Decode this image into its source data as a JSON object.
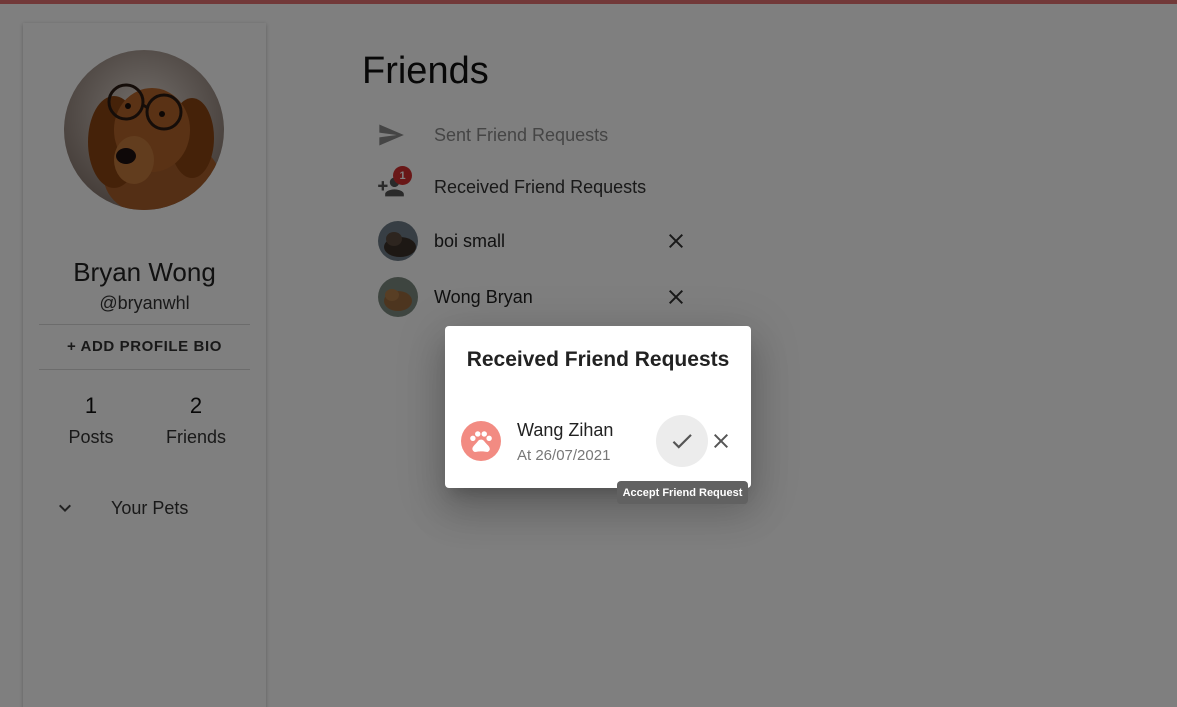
{
  "colors": {
    "topbar": "#e57373",
    "badge": "#d32f2f",
    "paw_avatar": "#f28b82",
    "overlay": "rgba(0,0,0,0.5)"
  },
  "sidebar": {
    "profile_name": "Bryan Wong",
    "profile_handle": "@bryanwhl",
    "add_bio_label": "+ ADD PROFILE BIO",
    "stats": [
      {
        "value": "1",
        "label": "Posts"
      },
      {
        "value": "2",
        "label": "Friends"
      }
    ],
    "pets_label": "Your Pets",
    "pets_icon": "chevron-down-icon"
  },
  "main": {
    "title": "Friends",
    "menu": [
      {
        "label": "Sent Friend Requests",
        "icon": "send-icon"
      },
      {
        "label": "Received Friend Requests",
        "icon": "person-add-icon",
        "badge": "1"
      }
    ],
    "friends": [
      {
        "name": "boi small",
        "remove_icon": "close-icon"
      },
      {
        "name": "Wong Bryan",
        "remove_icon": "close-icon"
      }
    ]
  },
  "dialog": {
    "title": "Received Friend Requests",
    "requests": [
      {
        "name": "Wang Zihan",
        "date": "At 26/07/2021",
        "avatar_icon": "paw-icon",
        "accept_icon": "check-icon",
        "decline_icon": "close-icon"
      }
    ],
    "tooltip": "Accept Friend Request"
  }
}
